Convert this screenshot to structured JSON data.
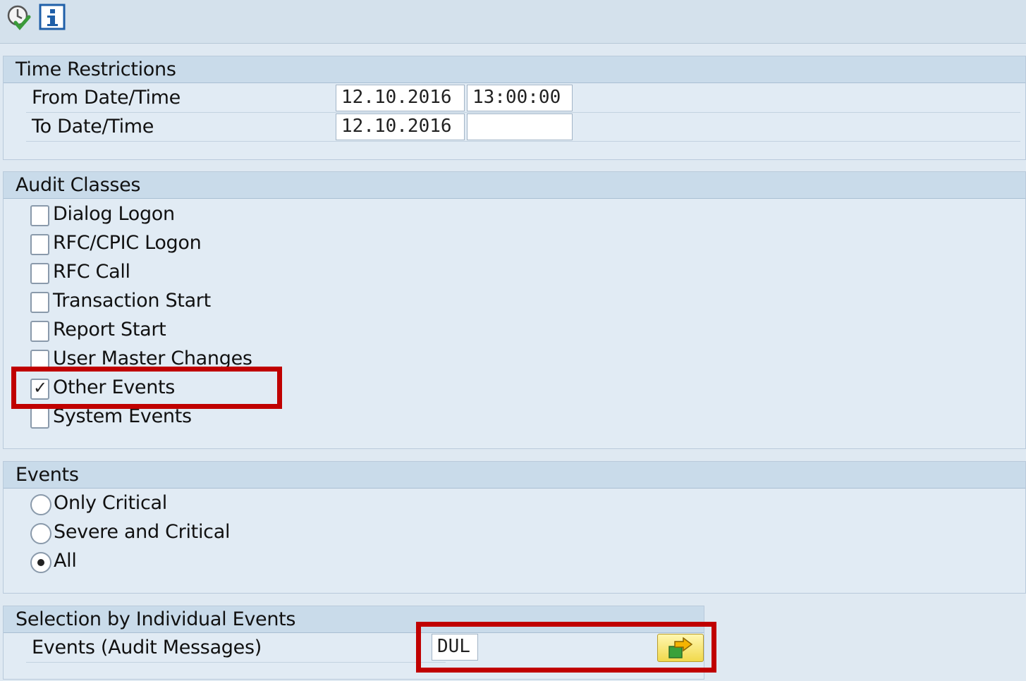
{
  "toolbar": {
    "icons": [
      "execute-clock-check-icon",
      "info-icon"
    ]
  },
  "time_restrictions": {
    "title": "Time Restrictions",
    "from_label": "From Date/Time",
    "from_date": "12.10.2016",
    "from_time": "13:00:00",
    "to_label": "To Date/Time",
    "to_date": "12.10.2016",
    "to_time": ""
  },
  "audit_classes": {
    "title": "Audit Classes",
    "items": [
      {
        "label": "Dialog Logon",
        "checked": false
      },
      {
        "label": "RFC/CPIC Logon",
        "checked": false
      },
      {
        "label": "RFC Call",
        "checked": false
      },
      {
        "label": "Transaction Start",
        "checked": false
      },
      {
        "label": "Report Start",
        "checked": false
      },
      {
        "label": "User Master Changes",
        "checked": false
      },
      {
        "label": "Other Events",
        "checked": true
      },
      {
        "label": "System Events",
        "checked": false
      }
    ]
  },
  "events": {
    "title": "Events",
    "options": [
      {
        "label": "Only Critical",
        "selected": false
      },
      {
        "label": "Severe and Critical",
        "selected": false
      },
      {
        "label": "All",
        "selected": true
      }
    ]
  },
  "individual_events": {
    "title": "Selection by Individual Events",
    "label": "Events (Audit Messages)",
    "value": "DUL"
  },
  "colors": {
    "highlight": "#c00000",
    "group_header": "#c9dbea",
    "background": "#dfe9f2"
  }
}
